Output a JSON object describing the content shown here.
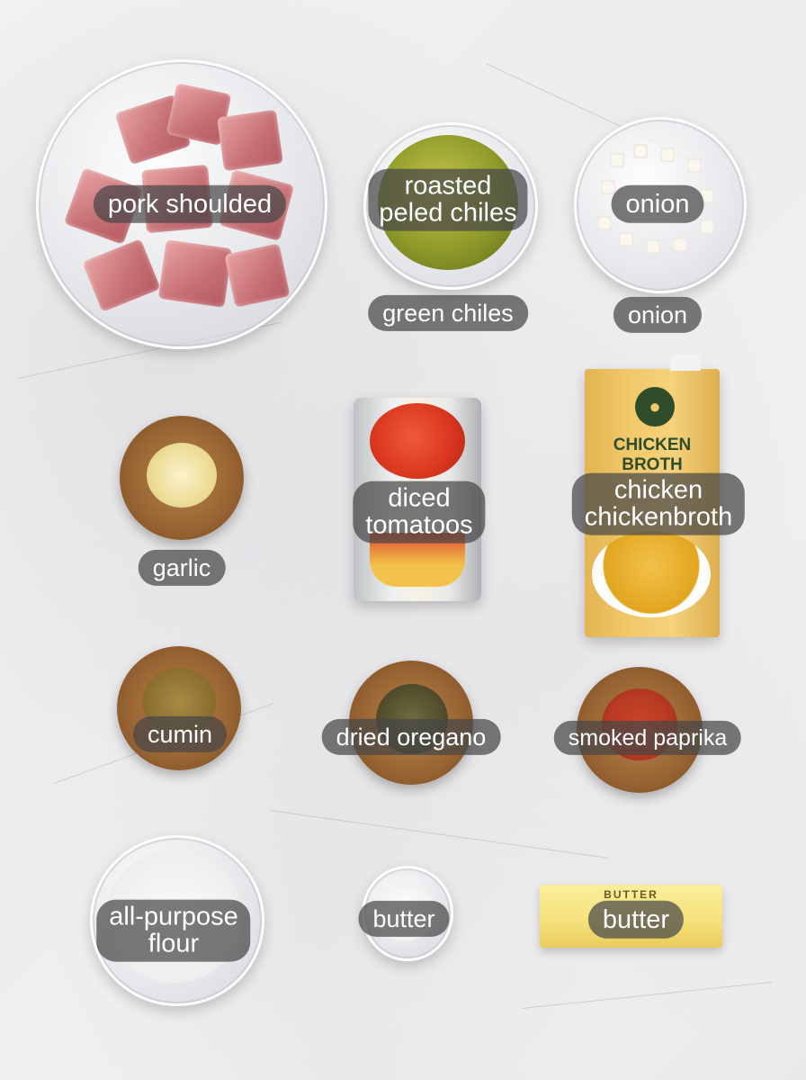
{
  "labels": {
    "pork": "pork shoulded",
    "chiles_top_1": "roasted",
    "chiles_top_2": "peled chiles",
    "chiles_bottom": "green chiles",
    "onion_top": "onion",
    "onion_bottom": "onion",
    "garlic": "garlic",
    "tomatoes_1": "diced",
    "tomatoes_2": "tomatoos",
    "broth_1": "chicken",
    "broth_2": "chickenbroth",
    "cumin": "cumin",
    "oregano": "dried oregano",
    "paprika": "smoked paprika",
    "flour_1": "all-purpose",
    "flour_2": "flour",
    "butter_small": "butter",
    "butter_stick": "butter"
  },
  "packaging": {
    "broth_carton_line1": "CHICKEN",
    "broth_carton_line2": "BROTH",
    "butter_wrapper": "BUTTER"
  },
  "colors": {
    "label_bg": "#464648",
    "label_text": "#ffffff",
    "broth_carton": "#f2c96b",
    "broth_text": "#2f4d2a",
    "paprika": "#b83a22",
    "tomato": "#d9361f",
    "chiles": "#8f9a2a"
  }
}
